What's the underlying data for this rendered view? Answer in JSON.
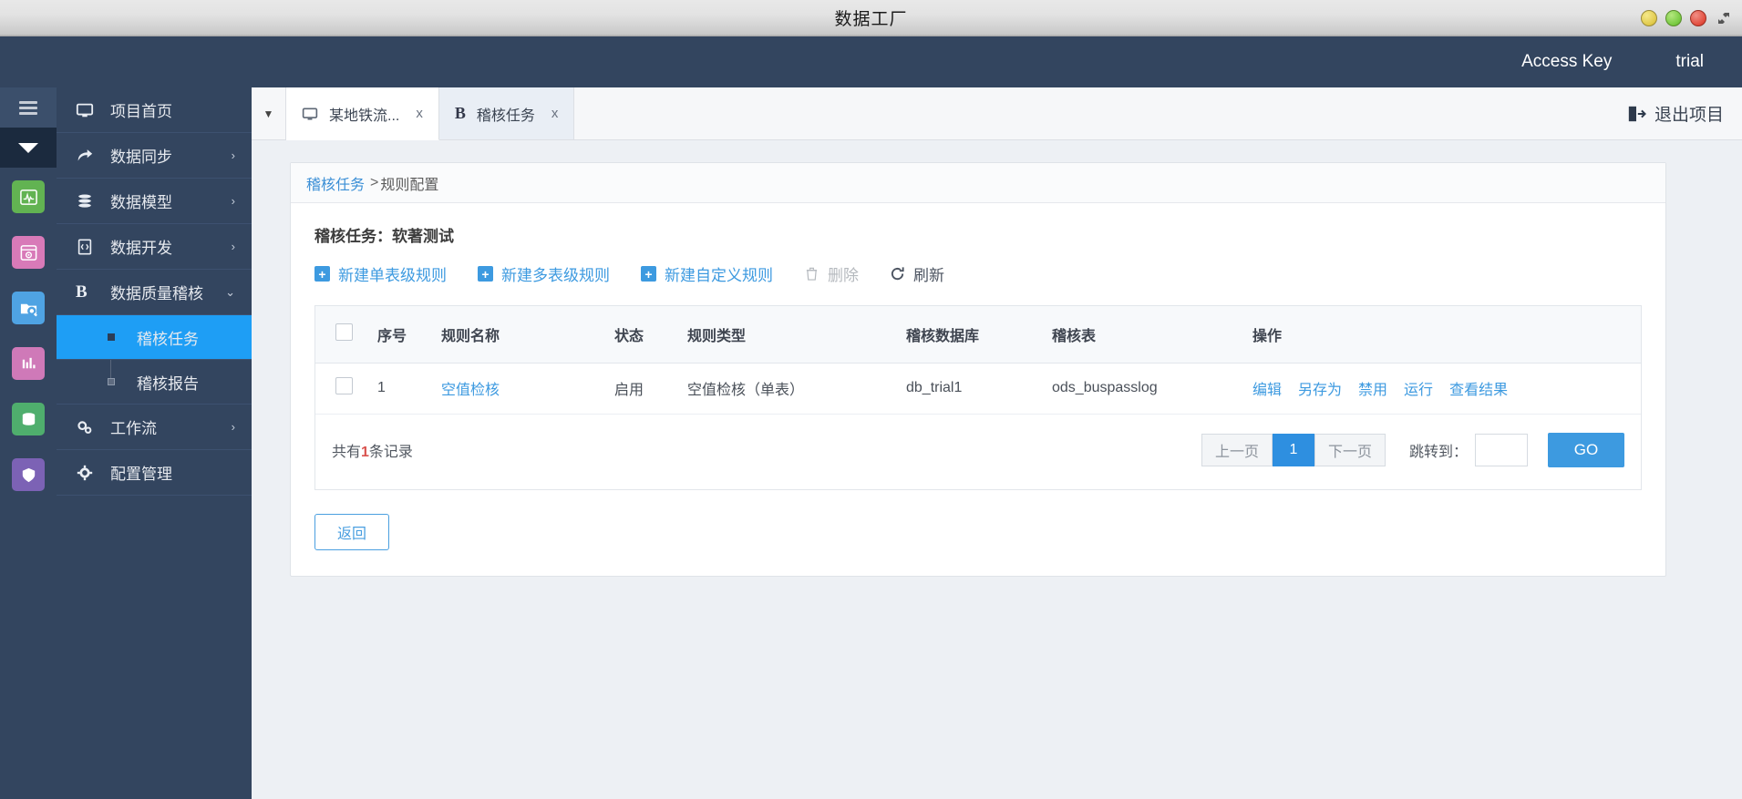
{
  "window": {
    "title": "数据工厂",
    "controls": [
      {
        "name": "minimize-button",
        "color": "#e0c94a"
      },
      {
        "name": "maximize-button",
        "color": "#76c940"
      },
      {
        "name": "close-button",
        "color": "#e24b3c"
      }
    ],
    "resize_icon": "resize-arrows-icon"
  },
  "topbar": {
    "access_key_label": "Access Key",
    "account_label": "trial",
    "background": "#33455f"
  },
  "rail": {
    "menu_icon": "hamburger-menu-icon",
    "caret_icon": "caret-down-icon",
    "apps": [
      {
        "name": "monitor-app-icon",
        "color": "#62b352",
        "glyph": "▣"
      },
      {
        "name": "scheduler-app-icon",
        "color": "#d87ab8",
        "glyph": "▩"
      },
      {
        "name": "data-explorer-app-icon",
        "color": "#4fa3e3",
        "glyph": "▤"
      },
      {
        "name": "analytics-app-icon",
        "color": "#cf79b8",
        "glyph": "▥"
      },
      {
        "name": "database-app-icon",
        "color": "#4fae6d",
        "glyph": "▦"
      },
      {
        "name": "security-app-icon",
        "color": "#7c62b5",
        "glyph": "▧"
      }
    ]
  },
  "sidebar": {
    "items": [
      {
        "label": "项目首页",
        "icon": "monitor-icon",
        "has_arrow": false
      },
      {
        "label": "数据同步",
        "icon": "share-arrow-icon",
        "has_arrow": true,
        "arrow": "›"
      },
      {
        "label": "数据模型",
        "icon": "database-stack-icon",
        "has_arrow": true,
        "arrow": "›"
      },
      {
        "label": "数据开发",
        "icon": "code-file-icon",
        "has_arrow": true,
        "arrow": "›"
      },
      {
        "label": "数据质量稽核",
        "icon": "bold-b-icon",
        "has_arrow": true,
        "arrow": "⌄",
        "expanded": true
      }
    ],
    "submenu": [
      {
        "label": "稽核任务",
        "active": true
      },
      {
        "label": "稽核报告",
        "active": false
      }
    ],
    "items_after": [
      {
        "label": "工作流",
        "icon": "gears-icon",
        "has_arrow": true,
        "arrow": "›"
      },
      {
        "label": "配置管理",
        "icon": "gear-icon",
        "has_arrow": false
      }
    ],
    "active_color": "#1e9ef5",
    "collapse_handle_icon": "chevron-left-icon"
  },
  "tabs": {
    "dropdown_icon": "chevron-down-icon",
    "items": [
      {
        "label": "某地铁流...",
        "icon": "monitor-icon",
        "close": "x",
        "state": "active"
      },
      {
        "label": "稽核任务",
        "icon": "bold-b-icon",
        "close": "x",
        "state": "current"
      }
    ],
    "logout": {
      "label": "退出项目",
      "icon": "logout-icon"
    }
  },
  "breadcrumb": {
    "link": "稽核任务",
    "separator": ">",
    "current": "规则配置"
  },
  "main": {
    "task_title": "稽核任务：软著测试",
    "toolbar": [
      {
        "label": "新建单表级规则",
        "icon": "plus-square-icon",
        "disabled": false
      },
      {
        "label": "新建多表级规则",
        "icon": "plus-square-icon",
        "disabled": false
      },
      {
        "label": "新建自定义规则",
        "icon": "plus-square-icon",
        "disabled": false
      },
      {
        "label": "删除",
        "icon": "trash-icon",
        "disabled": true
      },
      {
        "label": "刷新",
        "icon": "refresh-icon",
        "disabled": false
      }
    ],
    "table": {
      "columns": [
        "序号",
        "规则名称",
        "状态",
        "规则类型",
        "稽核数据库",
        "稽核表",
        "操作"
      ],
      "rows": [
        {
          "index": "1",
          "rule_name": "空值检核",
          "status": "启用",
          "rule_type": "空值检核（单表）",
          "database": "db_trial1",
          "table": "ods_buspasslog",
          "operations": [
            "编辑",
            "另存为",
            "禁用",
            "运行",
            "查看结果"
          ]
        }
      ]
    },
    "footer": {
      "record_prefix": "共有",
      "record_count": "1",
      "record_suffix": "条记录",
      "prev_label": "上一页",
      "current_page": "1",
      "next_label": "下一页",
      "jump_label": "跳转到：",
      "jump_value": "",
      "go_label": "GO"
    },
    "back_button": "返回"
  }
}
